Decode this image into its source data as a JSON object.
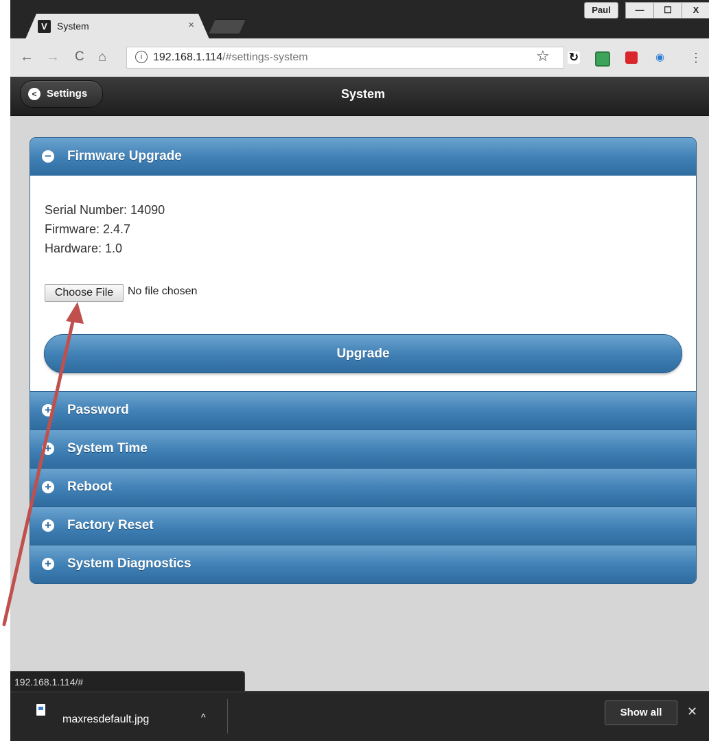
{
  "browser": {
    "tab_title": "System",
    "tab_close": "×",
    "profile_name": "Paul",
    "window_controls": {
      "minimize": "—",
      "maximize": "☐",
      "close": "X"
    },
    "url_host": "192.168.1.114",
    "url_path": "/#settings-system",
    "info_icon": "i",
    "back_icon": "←",
    "forward_icon": "→",
    "reload_icon": "C",
    "home_icon": "⌂",
    "star_icon": "☆",
    "menu_icon": "⋮"
  },
  "app": {
    "back_label": "Settings",
    "back_icon": "<",
    "title": "System"
  },
  "firmware": {
    "header": "Firmware Upgrade",
    "serial": "Serial Number: 14090",
    "firmware": "Firmware: 2.4.7",
    "hardware": "Hardware: 1.0",
    "choose_file": "Choose File",
    "no_file": "No file chosen",
    "upgrade": "Upgrade",
    "expanded": true
  },
  "sections": [
    {
      "label": "Password"
    },
    {
      "label": "System Time"
    },
    {
      "label": "Reboot"
    },
    {
      "label": "Factory Reset"
    },
    {
      "label": "System Diagnostics"
    }
  ],
  "status_url": "192.168.1.114/#",
  "downloads": {
    "file_name": "maxresdefault.jpg",
    "show_all": "Show all",
    "close": "✕",
    "caret": "^"
  },
  "colors": {
    "accent_blue": "#3f7fb4",
    "annotation_arrow": "#c0504d"
  }
}
